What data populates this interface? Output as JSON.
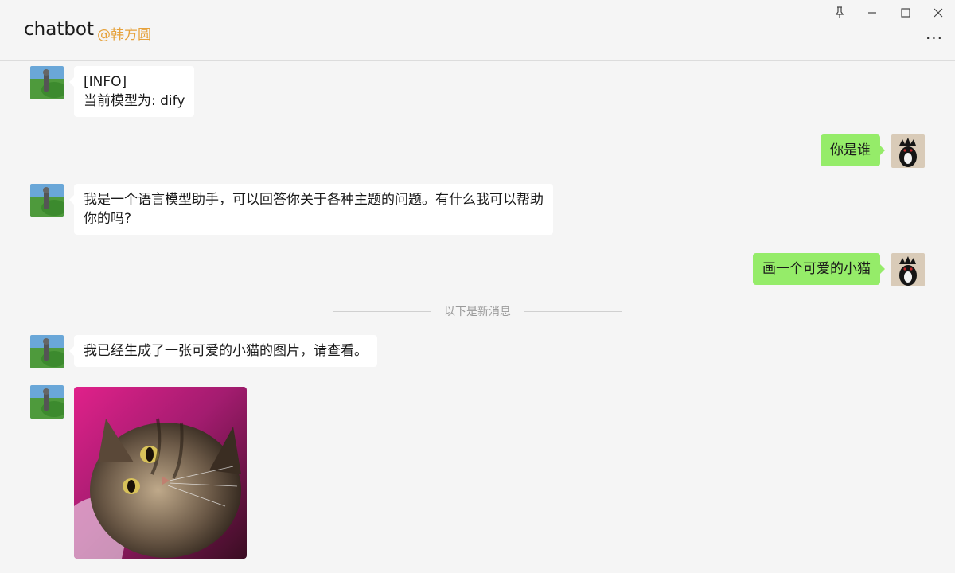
{
  "header": {
    "title": "chatbot",
    "subtitle": "@韩方圆"
  },
  "window_controls": [
    "pin-icon",
    "minimize-icon",
    "maximize-icon",
    "close-icon"
  ],
  "more_label": "···",
  "messages": [
    {
      "sender": "bot",
      "lines": [
        "[INFO]",
        "当前模型为: dify"
      ]
    },
    {
      "sender": "user",
      "lines": [
        "你是谁"
      ]
    },
    {
      "sender": "bot",
      "lines": [
        "我是一个语言模型助手，可以回答你关于各种主题的问题。有什么我可以帮助",
        "你的吗?"
      ]
    },
    {
      "sender": "user",
      "lines": [
        "画一个可爱的小猫"
      ]
    },
    {
      "sender": "bot",
      "lines": [
        "我已经生成了一张可爱的小猫的图片，请查看。"
      ]
    },
    {
      "sender": "bot",
      "type": "image",
      "image": "kitten-photo"
    }
  ],
  "divider_text": "以下是新消息",
  "colors": {
    "background": "#f5f5f5",
    "user_bubble": "#95ec69",
    "bot_bubble": "#ffffff",
    "subtitle": "#e6a23c"
  }
}
